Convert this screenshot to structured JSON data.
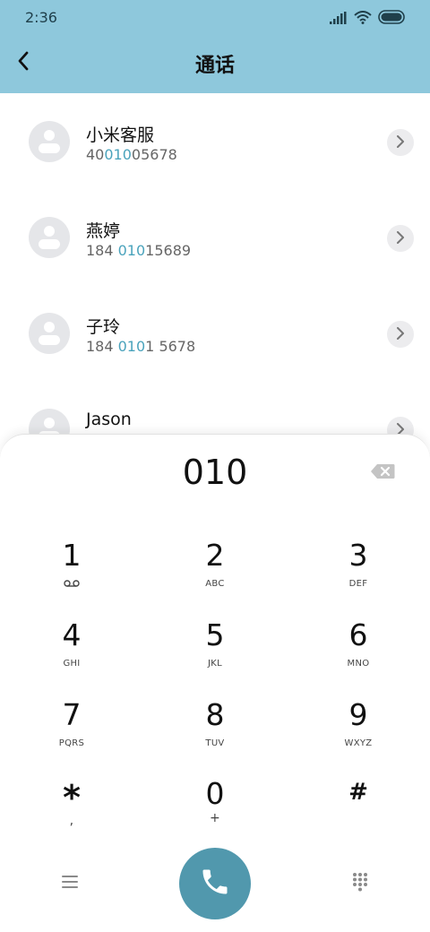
{
  "status_bar": {
    "time": "2:36"
  },
  "header": {
    "title": "通话"
  },
  "contacts": [
    {
      "name": "小米客服",
      "number_pre": "40",
      "number_match": "010",
      "number_post": "05678"
    },
    {
      "name": "燕婷",
      "number_pre": "184 ",
      "number_match": "010",
      "number_post": "15689"
    },
    {
      "name": "子玲",
      "number_pre": "184 ",
      "number_match": "010",
      "number_post": "1 5678"
    },
    {
      "name": "Jason",
      "number_pre": "",
      "number_match": "",
      "number_post": ""
    }
  ],
  "dialpad": {
    "dialed_number": "010",
    "keys": [
      {
        "digit": "1",
        "letters": ""
      },
      {
        "digit": "2",
        "letters": "ABC"
      },
      {
        "digit": "3",
        "letters": "DEF"
      },
      {
        "digit": "4",
        "letters": "GHI"
      },
      {
        "digit": "5",
        "letters": "JKL"
      },
      {
        "digit": "6",
        "letters": "MNO"
      },
      {
        "digit": "7",
        "letters": "PQRS"
      },
      {
        "digit": "8",
        "letters": "TUV"
      },
      {
        "digit": "9",
        "letters": "WXYZ"
      },
      {
        "digit": "*",
        "letters": ","
      },
      {
        "digit": "0",
        "letters": "+"
      },
      {
        "digit": "#",
        "letters": ""
      }
    ]
  },
  "icons": {
    "back": "chevron-left-icon",
    "backspace": "backspace-icon",
    "voicemail": "voicemail-icon",
    "menu": "menu-icon",
    "call": "phone-icon",
    "keypad": "dialpad-icon"
  },
  "colors": {
    "header_bg": "#8ec8dc",
    "match_highlight": "#4aa3bc",
    "call_button": "#5198ad"
  }
}
